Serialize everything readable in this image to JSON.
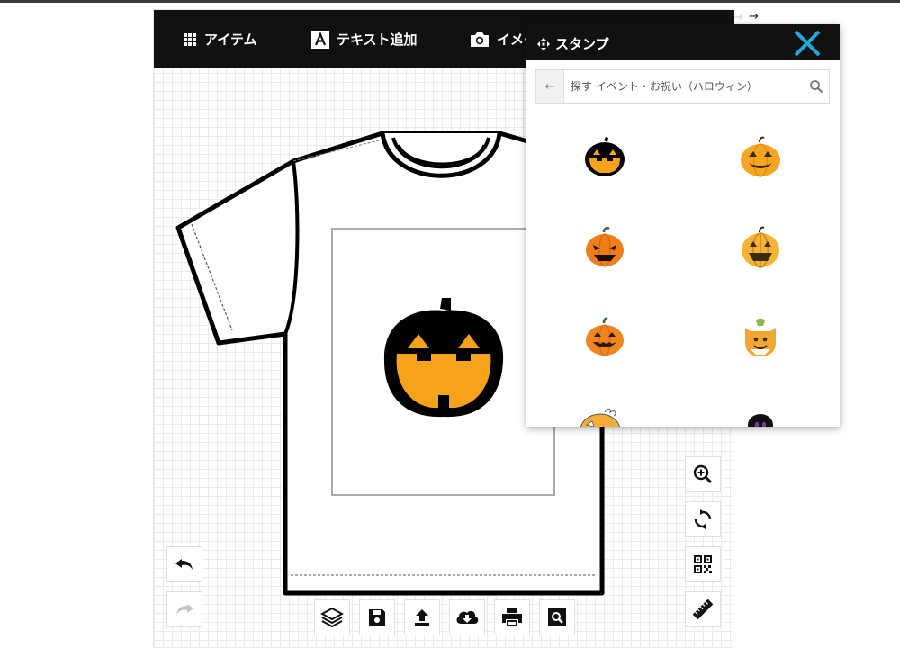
{
  "toolbar": {
    "item_label": "アイテム",
    "text_label": "テキスト追加",
    "image_label": "イメー"
  },
  "panel": {
    "title": "スタンプ",
    "search_placeholder": "探す イベント・お祝い（ハロウィン）"
  },
  "stamps": [
    {
      "icon": "pumpkin-black-outline-icon"
    },
    {
      "icon": "pumpkin-orange-icon"
    },
    {
      "icon": "pumpkin-dark-eyes-icon"
    },
    {
      "icon": "pumpkin-striped-icon"
    },
    {
      "icon": "pumpkin-small-icon"
    },
    {
      "icon": "pumpkin-ghost-icon"
    },
    {
      "icon": "pumpkin-outline-icon"
    },
    {
      "icon": "dark-ghost-icon"
    }
  ],
  "colors": {
    "toolbar_bg": "#111111",
    "accent_close": "#1fa9d6",
    "pumpkin_orange": "#f7a21b"
  }
}
